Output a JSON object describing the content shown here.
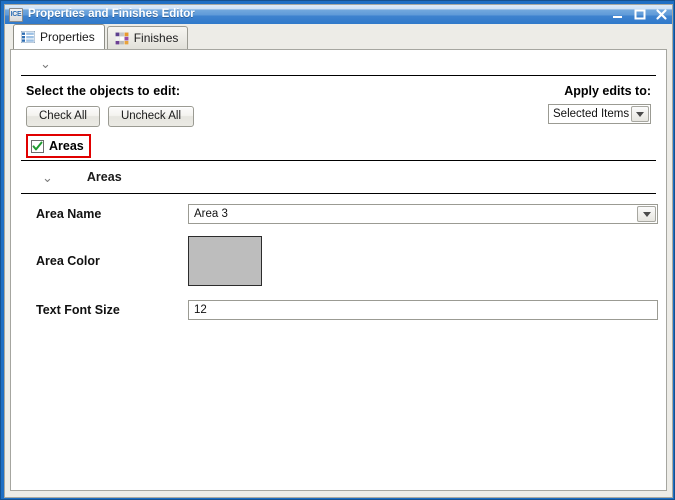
{
  "window": {
    "title": "Properties and Finishes Editor",
    "app_icon_text": "ICE",
    "minimize_label": "Minimize",
    "maximize_label": "Maximize",
    "close_label": "Close"
  },
  "tabs": [
    {
      "label": "Properties",
      "icon": "list-icon",
      "active": true
    },
    {
      "label": "Finishes",
      "icon": "color-swatches-icon",
      "active": false
    }
  ],
  "panel": {
    "collapse_chevron": "⌄",
    "select_objects_title": "Select the objects to edit:",
    "check_all_label": "Check All",
    "uncheck_all_label": "Uncheck All",
    "apply_edits_label": "Apply edits to:",
    "apply_edits_value": "Selected Items",
    "apply_edits_options": [
      "Selected Items"
    ],
    "areas_checkbox_label": "Areas",
    "areas_checkbox_checked": true,
    "areas_group_title": "Areas",
    "areas_group_chevron": "⌄"
  },
  "form": {
    "area_name": {
      "label": "Area Name",
      "value": "Area 3",
      "options": [
        "Area 3"
      ]
    },
    "area_color": {
      "label": "Area Color",
      "value": "#bdbdbd"
    },
    "text_font_size": {
      "label": "Text Font Size",
      "value": "12"
    }
  },
  "colors": {
    "titlebar_blue": "#3f83cf",
    "window_border_blue": "#1f6fc4",
    "highlight_red": "#e00000",
    "checkmark_green": "#1f9b30",
    "panel_background": "#edece7",
    "swatch_gray": "#bdbdbd"
  }
}
